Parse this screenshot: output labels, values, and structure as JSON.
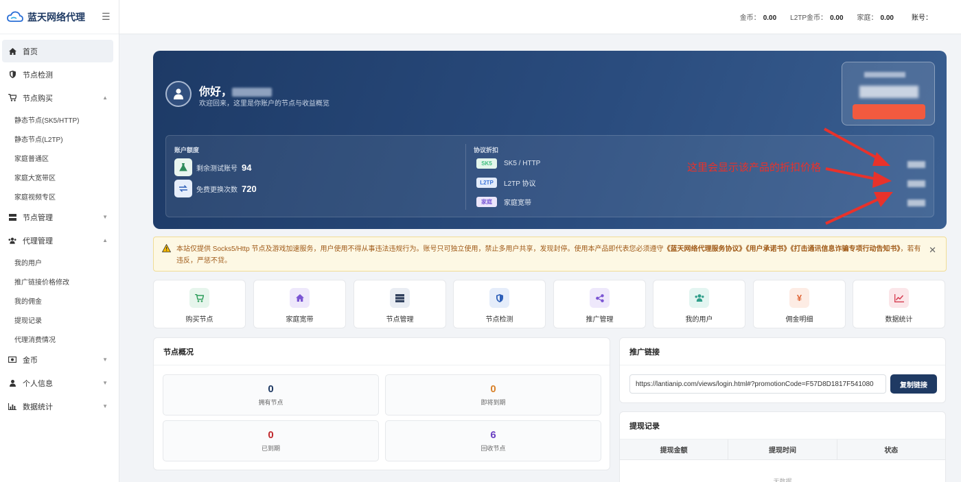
{
  "brand": {
    "name": "蓝天网络代理"
  },
  "sidebar": {
    "items": [
      {
        "label": "首页"
      },
      {
        "label": "节点检测"
      },
      {
        "label": "节点购买"
      },
      {
        "label": "节点管理"
      },
      {
        "label": "代理管理"
      },
      {
        "label": "金币"
      },
      {
        "label": "个人信息"
      },
      {
        "label": "数据统计"
      }
    ],
    "purchase_sub": [
      "静态节点(SK5/HTTP)",
      "静态节点(L2TP)",
      "家庭普通区",
      "家庭大宽带区",
      "家庭视频专区"
    ],
    "agent_sub": [
      "我的用户",
      "推广链接价格修改",
      "我的佣金",
      "提现记录",
      "代理消费情况"
    ]
  },
  "topbar": {
    "coins_label": "金币：",
    "coins_value": "0.00",
    "l2tp_label": "L2TP金币：",
    "l2tp_value": "0.00",
    "home_label": "家庭：",
    "home_value": "0.00",
    "account_label": "账号："
  },
  "hero": {
    "greeting": "你好，",
    "welcome": "欢迎回来，这里是你账户的节点与收益概览",
    "quota_title": "账户额度",
    "quota": [
      {
        "label": "剩余测试账号",
        "value": "94"
      },
      {
        "label": "免费更换次数",
        "value": "720"
      }
    ],
    "proto_title": "协议折扣",
    "protocols": [
      {
        "tag": "SK5",
        "name": "SK5 / HTTP",
        "color": "#3fbf7f",
        "bg": "#e4f6ec"
      },
      {
        "tag": "L2TP",
        "name": "L2TP 协议",
        "color": "#3b74d8",
        "bg": "#e3ecfb"
      },
      {
        "tag": "家庭",
        "name": "家庭宽带",
        "color": "#7c5cd6",
        "bg": "#ece6fb"
      }
    ],
    "annotation": "这里会显示该产品的折扣价格"
  },
  "notice": {
    "text_before": "本站仅提供 Socks5/Http 节点及游戏加速服务，用户使用不得从事违法违规行为。账号只可独立使用，禁止多用户共享，发现封停。使用本产品即代表您必须遵守",
    "doc1": "《蓝天网络代理服务协议》",
    "doc2": "《用户承诺书》",
    "doc3": "《打击通讯信息诈骗专项行动告知书》",
    "text_after": "，若有违反，严惩不贷。"
  },
  "quick_actions": [
    {
      "label": "购买节点",
      "icon": "cart-icon",
      "color": "#2f9e5c",
      "bg": "#e6f5ec"
    },
    {
      "label": "家庭宽带",
      "icon": "home-icon",
      "color": "#7b55d3",
      "bg": "#eee8fb"
    },
    {
      "label": "节点管理",
      "icon": "server-icon",
      "color": "#2f3f5c",
      "bg": "#e9edf3"
    },
    {
      "label": "节点检测",
      "icon": "shield-icon",
      "color": "#2d5fb8",
      "bg": "#e5edfa"
    },
    {
      "label": "推广管理",
      "icon": "share-icon",
      "color": "#7b55d3",
      "bg": "#eee8fb"
    },
    {
      "label": "我的用户",
      "icon": "users-icon",
      "color": "#2f9e8a",
      "bg": "#e3f5f1"
    },
    {
      "label": "佣金明细",
      "icon": "yen-icon",
      "color": "#e0683a",
      "bg": "#fdece4"
    },
    {
      "label": "数据统计",
      "icon": "line-chart-icon",
      "color": "#d63b4f",
      "bg": "#fbe6e9"
    }
  ],
  "node_overview": {
    "title": "节点概况",
    "stats": [
      {
        "value": "0",
        "label": "拥有节点",
        "color": "#1f3a63"
      },
      {
        "value": "0",
        "label": "即将到期",
        "color": "#d9822b"
      },
      {
        "value": "0",
        "label": "已到期",
        "color": "#c0282d"
      },
      {
        "value": "6",
        "label": "回收节点",
        "color": "#6a3fc2"
      }
    ]
  },
  "promo_link": {
    "title": "推广链接",
    "value": "https://lantianip.com/views/login.html#?promotionCode=F57D8D1817F541080",
    "copy_label": "复制链接"
  },
  "withdraw": {
    "title": "提现记录",
    "columns": [
      "提现金额",
      "提现时间",
      "状态"
    ],
    "empty": "无数据"
  }
}
